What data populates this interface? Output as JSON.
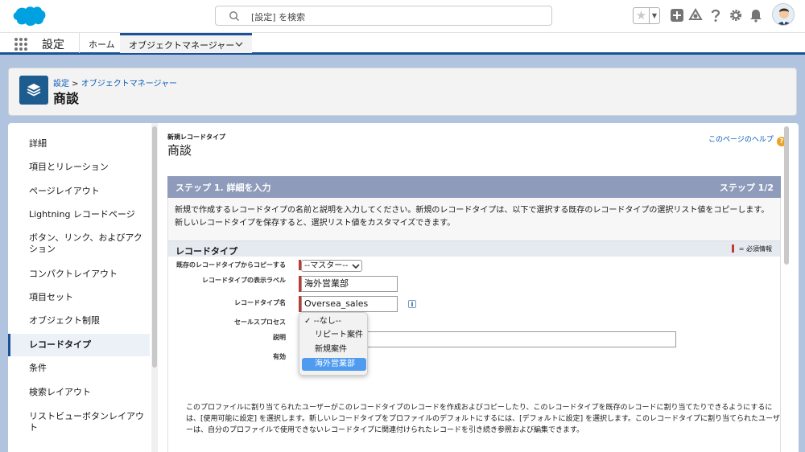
{
  "header": {
    "logo_icon": "salesforce-cloud-icon",
    "search_placeholder": "[設定] を検索",
    "icons": [
      "favorites-star-icon",
      "add-icon",
      "trailhead-icon",
      "help-icon",
      "gear-icon",
      "bell-icon"
    ],
    "brand_color": "#00a1e0"
  },
  "nav": {
    "app_name": "設定",
    "home": "ホーム",
    "active_tab": "オブジェクトマネージャー"
  },
  "page_header": {
    "crumb_setup": "設定",
    "crumb_sep": " > ",
    "crumb_object_manager": "オブジェクトマネージャー",
    "title": "商談"
  },
  "sidebar": {
    "items": [
      {
        "label": "詳細",
        "active": false
      },
      {
        "label": "項目とリレーション",
        "active": false
      },
      {
        "label": "ページレイアウト",
        "active": false
      },
      {
        "label": "Lightning レコードページ",
        "active": false
      },
      {
        "label": "ボタン、リンク、およびアクション",
        "active": false
      },
      {
        "label": "コンパクトレイアウト",
        "active": false
      },
      {
        "label": "項目セット",
        "active": false
      },
      {
        "label": "オブジェクト制限",
        "active": false
      },
      {
        "label": "レコードタイプ",
        "active": true
      },
      {
        "label": "条件",
        "active": false
      },
      {
        "label": "検索レイアウト",
        "active": false
      },
      {
        "label": "リストビューボタンレイアウト",
        "active": false
      }
    ]
  },
  "main": {
    "subtitle": "新規レコードタイプ",
    "title": "商談",
    "help_link": "このページのヘルプ",
    "step_label": "ステップ 1. 詳細を入力",
    "step_count": "ステップ 1/2",
    "intro": "新規で作成するレコードタイプの名前と説明を入力してください。新規のレコードタイプは、以下で選択する既存のレコードタイプの選択リスト値をコピーします。新しいレコードタイプを保存すると、選択リスト値をカスタマイズできます。",
    "section_title": "レコードタイプ",
    "required_info": "= 必須情報",
    "form": {
      "copy_from_label": "既存のレコードタイプからコピーする",
      "copy_from_value": "--マスター--",
      "display_label_label": "レコードタイプの表示ラベル",
      "display_label_value": "海外営業部",
      "name_label": "レコードタイプ名",
      "name_value": "Oversea_sales",
      "sales_process_label": "セールスプロセス",
      "description_label": "説明",
      "active_label": "有効"
    },
    "sales_process_options": [
      {
        "label": "--なし--",
        "checked": true,
        "highlighted": false
      },
      {
        "label": "リピート案件",
        "checked": false,
        "highlighted": false
      },
      {
        "label": "新規案件",
        "checked": false,
        "highlighted": false
      },
      {
        "label": "海外営業部",
        "checked": false,
        "highlighted": true
      }
    ],
    "bottom_note": "このプロファイルに割り当てられたユーザーがこのレコードタイプのレコードを作成およびコピーしたり、このレコードタイプを既存のレコードに割り当てたりできるようにするには、[使用可能に設定] を選択します。新しいレコードタイプをプロファイルのデフォルトにするには、[デフォルトに設定] を選択します。このレコードタイプに割り当てられたユーザーは、自分のプロファイルで使用できないレコードタイプに関連付けられたレコードを引き続き参照および編集できます。"
  }
}
